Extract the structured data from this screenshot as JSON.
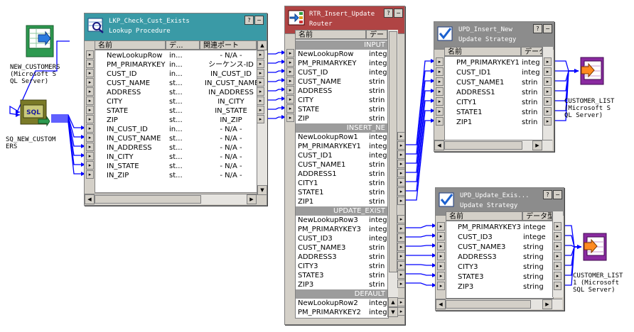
{
  "sources": {
    "new_customers": {
      "label": "NEW_CUSTOMERS\n(Microsoft S\nQL Server)",
      "icon": "source-table-icon"
    },
    "sq_new_customers": {
      "label": "SQ_NEW_CUSTOM\nERS",
      "icon_text": "SQL"
    }
  },
  "targets": {
    "customer_list": {
      "label": "CUSTOMER_LIST\n(Microsoft S\nQL Server)"
    },
    "customer_list1": {
      "label": "CUSTOMER_LIST\n1 (Microsoft\nSQL Server)"
    }
  },
  "title_buttons": {
    "help": "?",
    "minimize": "−"
  },
  "lookup": {
    "title": "LKP_Check_Cust_Exists",
    "subtitle": "Lookup Procedure",
    "columns": [
      "名前",
      "デ...",
      "関連ポート"
    ],
    "rows": [
      [
        "NewLookupRow",
        "in...",
        "- N/A -"
      ],
      [
        "PM_PRIMARYKEY",
        "in...",
        "シーケンス-ID"
      ],
      [
        "CUST_ID",
        "in...",
        "IN_CUST_ID"
      ],
      [
        "CUST_NAME",
        "st...",
        "IN_CUST_NAME"
      ],
      [
        "ADDRESS",
        "st...",
        "IN_ADDRESS"
      ],
      [
        "CITY",
        "st...",
        "IN_CITY"
      ],
      [
        "STATE",
        "st...",
        "IN_STATE"
      ],
      [
        "ZIP",
        "st...",
        "IN_ZIP"
      ],
      [
        "IN_CUST_ID",
        "in...",
        "- N/A -"
      ],
      [
        "IN_CUST_NAME",
        "st...",
        "- N/A -"
      ],
      [
        "IN_ADDRESS",
        "st...",
        "- N/A -"
      ],
      [
        "IN_CITY",
        "st...",
        "- N/A -"
      ],
      [
        "IN_STATE",
        "st...",
        "- N/A -"
      ],
      [
        "IN_ZIP",
        "st...",
        "- N/A -"
      ]
    ]
  },
  "router": {
    "title": "RTR_Insert_Update",
    "subtitle": "Router",
    "columns": [
      "名前",
      "デー"
    ],
    "groups": [
      {
        "name": "INPUT",
        "rows": [
          [
            "NewLookupRow",
            "integ"
          ],
          [
            "PM_PRIMARYKEY",
            "integ"
          ],
          [
            "CUST_ID",
            "integ"
          ],
          [
            "CUST_NAME",
            "strin"
          ],
          [
            "ADDRESS",
            "strin"
          ],
          [
            "CITY",
            "strin"
          ],
          [
            "STATE",
            "strin"
          ],
          [
            "ZIP",
            "strin"
          ]
        ]
      },
      {
        "name": "INSERT_NE",
        "rows": [
          [
            "NewLookupRow1",
            "integ"
          ],
          [
            "PM_PRIMARYKEY1",
            "integ"
          ],
          [
            "CUST_ID1",
            "integ"
          ],
          [
            "CUST_NAME1",
            "strin"
          ],
          [
            "ADDRESS1",
            "strin"
          ],
          [
            "CITY1",
            "strin"
          ],
          [
            "STATE1",
            "strin"
          ],
          [
            "ZIP1",
            "strin"
          ]
        ]
      },
      {
        "name": "UPDATE_EXIST",
        "rows": [
          [
            "NewLookupRow3",
            "integ"
          ],
          [
            "PM_PRIMARYKEY3",
            "integ"
          ],
          [
            "CUST_ID3",
            "integ"
          ],
          [
            "CUST_NAME3",
            "strin"
          ],
          [
            "ADDRESS3",
            "strin"
          ],
          [
            "CITY3",
            "strin"
          ],
          [
            "STATE3",
            "strin"
          ],
          [
            "ZIP3",
            "strin"
          ]
        ]
      },
      {
        "name": "DEFAULT",
        "rows": [
          [
            "NewLookupRow2",
            "integ"
          ],
          [
            "PM_PRIMARYKEY2",
            "integ"
          ]
        ]
      }
    ]
  },
  "upd_insert": {
    "title": "UPD_Insert_New",
    "subtitle": "Update Strategy",
    "columns": [
      "名前",
      "データ"
    ],
    "rows": [
      [
        "PM_PRIMARYKEY1",
        "integ"
      ],
      [
        "CUST_ID1",
        "integ"
      ],
      [
        "CUST_NAME1",
        "strin"
      ],
      [
        "ADDRESS1",
        "strin"
      ],
      [
        "CITY1",
        "strin"
      ],
      [
        "STATE1",
        "strin"
      ],
      [
        "ZIP1",
        "strin"
      ]
    ]
  },
  "upd_update": {
    "title": "UPD_Update_Exis...",
    "subtitle": "Update Strategy",
    "columns": [
      "名前",
      "データ型"
    ],
    "rows": [
      [
        "PM_PRIMARYKEY3",
        "intege"
      ],
      [
        "CUST_ID3",
        "intege"
      ],
      [
        "CUST_NAME3",
        "string"
      ],
      [
        "ADDRESS3",
        "string"
      ],
      [
        "CITY3",
        "string"
      ],
      [
        "STATE3",
        "string"
      ],
      [
        "ZIP3",
        "string"
      ]
    ]
  },
  "colors": {
    "lookup_header": "#3a9aa6",
    "router_header": "#b04444",
    "update_header": "#8c8c8c",
    "link": "#0000ff",
    "target": "#8a2aa0",
    "source": "#2e9a50",
    "sq": "#7a7a28"
  }
}
